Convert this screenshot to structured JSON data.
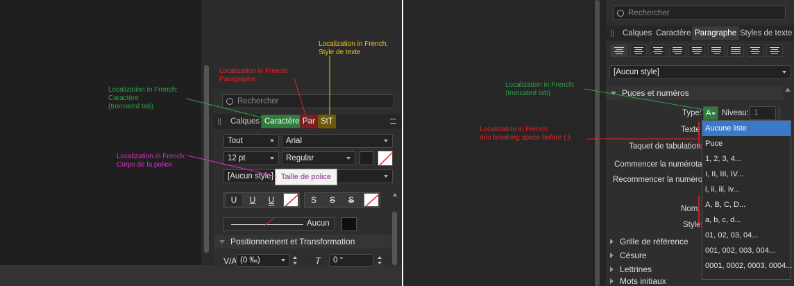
{
  "left": {
    "search_placeholder": "Rechercher",
    "tabs": [
      "Calques",
      "Caractère",
      "Par",
      "StT"
    ],
    "font_collection": "Tout",
    "font_family": "Arial",
    "font_size": "12 pt",
    "font_style": "Regular",
    "style_select": "[Aucun style]",
    "tooltip": "Taille de police",
    "decor_buttons": [
      "U",
      "U",
      "U",
      "S",
      "S",
      "S"
    ],
    "underline_label": "Aucun",
    "section": "Positionnement et Transformation",
    "kerning_value": "(0 ‰)",
    "skew_value": "0 °"
  },
  "right": {
    "search_placeholder": "Rechercher",
    "tabs": [
      "Calques",
      "Caractère",
      "Paragraphe",
      "Styles de texte"
    ],
    "style_select": "[Aucun style]",
    "section_bullets": "Puces et numéros",
    "type_label": "Type:",
    "type_value": "A",
    "level_label": "Niveau:",
    "level_value": "1",
    "rows": [
      "Texte",
      "Taquet de tabulation:",
      "Commencer la numérotati",
      "Recommencer la numérota",
      "Nom:",
      "Style:"
    ],
    "sections": [
      "Grille de référence",
      "Césure",
      "Lettrines",
      "Mots initiaux"
    ],
    "menu": [
      "Aucune liste",
      "Puce",
      "1, 2, 3, 4...",
      "I, II, III, IV...",
      "i, ii, iii, iv...",
      "A, B, C, D...",
      "a, b, c, d...",
      "01, 02, 03, 04...",
      "001, 002, 003, 004...",
      "0001, 0002, 0003, 0004..."
    ]
  },
  "notes": {
    "n1": "Localization in French:\nStyle de texte",
    "n2": "Localization in French:\nParagraphe",
    "n3": "Localization in French:\nCaractère\n(troncated tab)",
    "n4": "Localization in French:\nCorps de la police",
    "n5": "Localization in French:\n(troncated tab)",
    "n6": "Localization in French:\nnon breaking space before (:)."
  },
  "colors": {
    "green": "#2fa24a",
    "red": "#e3252a",
    "yellow": "#f2c521",
    "magenta": "#e42ad1",
    "tab_green": "#2e7d3c",
    "tab_red": "#7a1f23",
    "tab_yellow": "#6d5a08",
    "menu_highlight": "#3a78c9"
  }
}
